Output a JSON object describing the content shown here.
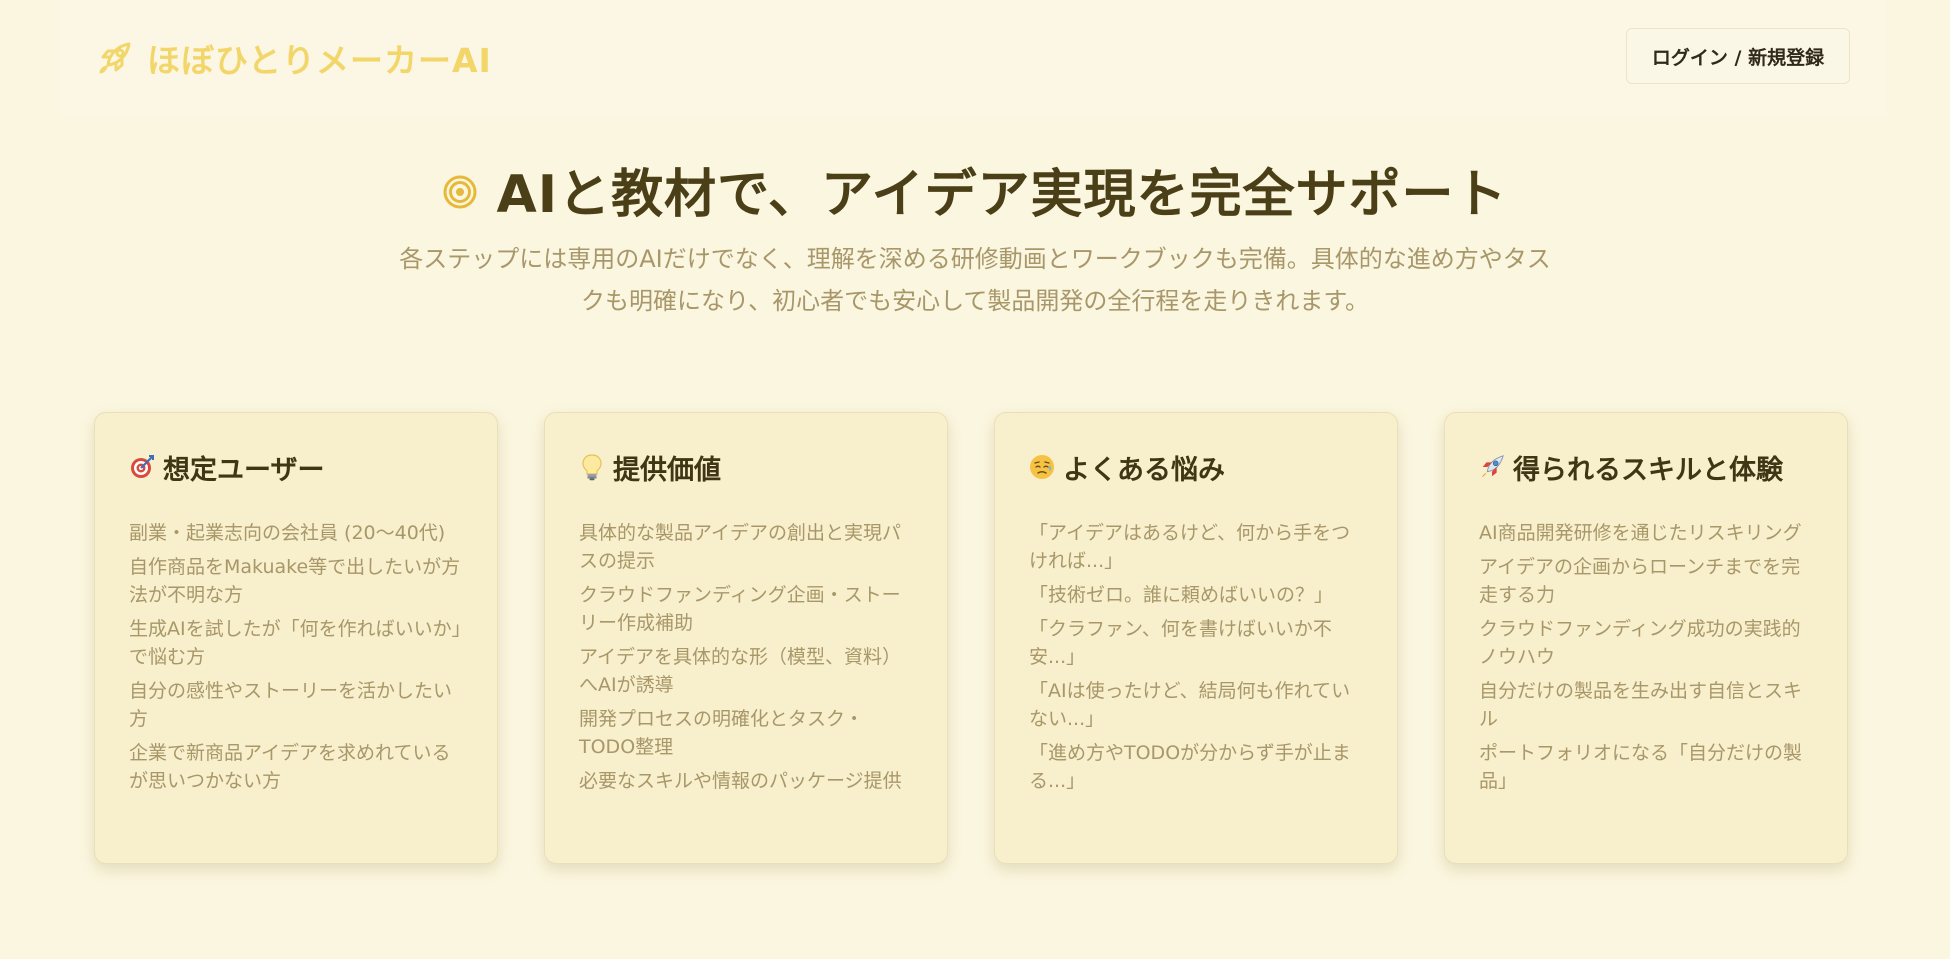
{
  "header": {
    "brand_icon": "rocket-icon",
    "brand_name": "ほぼひとりメーカーAI",
    "login_label": "ログイン / 新規登録"
  },
  "hero": {
    "icon": "target-icon",
    "title": "AIと教材で、アイデア実現を完全サポート",
    "subtitle": "各ステップには専用のAIだけでなく、理解を深める研修動画とワークブックも完備。具体的な進め方やタスクも明確になり、初心者でも安心して製品開発の全行程を走りきれます。"
  },
  "cards": [
    {
      "icon": "dart-icon",
      "title": "想定ユーザー",
      "items": [
        "副業・起業志向の会社員 (20〜40代)",
        "自作商品をMakuake等で出したいが方法が不明な方",
        "生成AIを試したが「何を作ればいいか」で悩む方",
        "自分の感性やストーリーを活かしたい方",
        "企業で新商品アイデアを求めれているが思いつかない方"
      ]
    },
    {
      "icon": "lightbulb-icon",
      "title": "提供価値",
      "items": [
        "具体的な製品アイデアの創出と実現パスの提示",
        "クラウドファンディング企画・ストーリー作成補助",
        "アイデアを具体的な形（模型、資料）へAIが誘導",
        "開発プロセスの明確化とタスク・TODO整理",
        "必要なスキルや情報のパッケージ提供"
      ]
    },
    {
      "icon": "worried-face-icon",
      "title": "よくある悩み",
      "items": [
        "「アイデアはあるけど、何から手をつければ...」",
        "「技術ゼロ。誰に頼めばいいの？」",
        "「クラファン、何を書けばいいか不安...」",
        "「AIは使ったけど、結局何も作れていない...」",
        "「進め方やTODOが分からず手が止まる...」"
      ]
    },
    {
      "icon": "rocket-icon",
      "title": "得られるスキルと体験",
      "items": [
        "AI商品開発研修を通じたリスキリング",
        "アイデアの企画からローンチまでを完走する力",
        "クラウドファンディング成功の実践的ノウハウ",
        "自分だけの製品を生み出す自信とスキル",
        "ポートフォリオになる「自分だけの製品」"
      ]
    }
  ],
  "colors": {
    "background": "#fbf6df",
    "brand": "#f3d669",
    "card": "#f8efcd",
    "muted_text": "#a89769",
    "heading": "#4b3f17"
  }
}
